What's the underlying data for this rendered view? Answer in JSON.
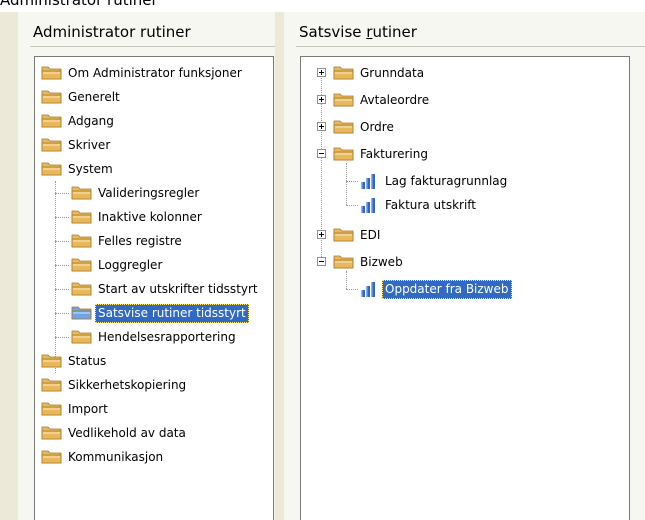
{
  "top_strip_text": "Administrator rutiner",
  "left_panel": {
    "title": "Administrator rutiner",
    "items": [
      {
        "label": "Om Administrator funksjoner",
        "level": 0
      },
      {
        "label": "Generelt",
        "level": 0
      },
      {
        "label": "Adgang",
        "level": 0
      },
      {
        "label": "Skriver",
        "level": 0
      },
      {
        "label": "System",
        "level": 0
      },
      {
        "label": "Valideringsregler",
        "level": 1
      },
      {
        "label": "Inaktive kolonner",
        "level": 1
      },
      {
        "label": "Felles registre",
        "level": 1
      },
      {
        "label": "Loggregler",
        "level": 1
      },
      {
        "label": "Start av utskrifter tidsstyrt",
        "level": 1
      },
      {
        "label": "Satsvise rutiner tidsstyrt",
        "level": 1,
        "selected": true
      },
      {
        "label": "Hendelsesrapportering",
        "level": 1
      },
      {
        "label": "Status",
        "level": 0
      },
      {
        "label": "Sikkerhetskopiering",
        "level": 0
      },
      {
        "label": "Import",
        "level": 0
      },
      {
        "label": "Vedlikehold av data",
        "level": 0
      },
      {
        "label": "Kommunikasjon",
        "level": 0
      }
    ]
  },
  "right_panel": {
    "title_before_mnemonic": "Satsvise ",
    "title_mnemonic": "r",
    "title_after_mnemonic": "utiner",
    "items": [
      {
        "label": "Grunndata",
        "type": "folder",
        "expander": "plus"
      },
      {
        "label": "Avtaleordre",
        "type": "folder",
        "expander": "plus"
      },
      {
        "label": "Ordre",
        "type": "folder",
        "expander": "plus"
      },
      {
        "label": "Fakturering",
        "type": "folder",
        "expander": "minus"
      },
      {
        "label": "Lag fakturagrunnlag",
        "type": "report"
      },
      {
        "label": "Faktura utskrift",
        "type": "report"
      },
      {
        "label": "EDI",
        "type": "folder",
        "expander": "plus"
      },
      {
        "label": "Bizweb",
        "type": "folder",
        "expander": "minus"
      },
      {
        "label": "Oppdater fra Bizweb",
        "type": "report",
        "selected": true
      }
    ]
  },
  "colors": {
    "selection": "#316ac5",
    "folder_body": "#e8b95a",
    "folder_selected": "#6ea5e6",
    "chart_bars": "#2f66c8"
  }
}
